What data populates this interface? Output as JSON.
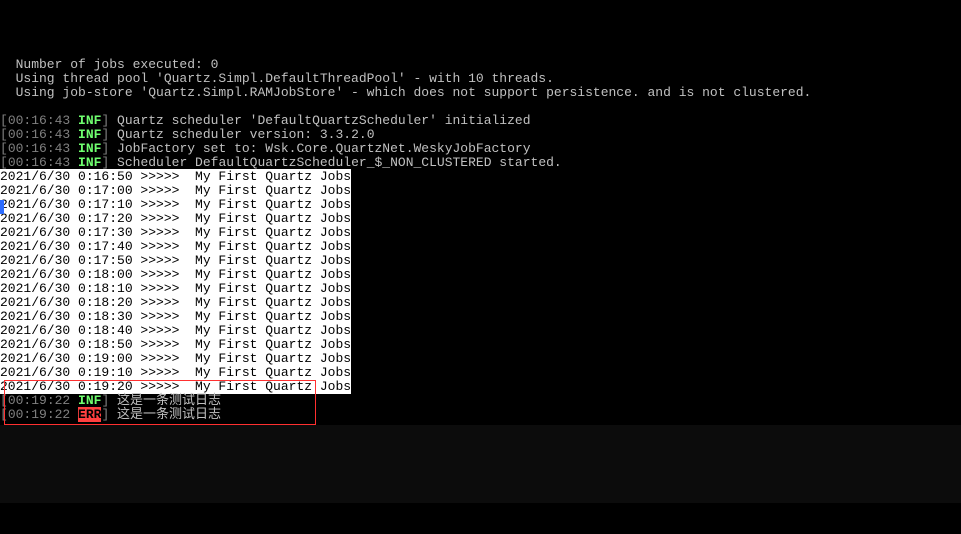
{
  "startup": [
    "  Number of jobs executed: 0",
    "  Using thread pool 'Quartz.Simpl.DefaultThreadPool' - with 10 threads.",
    "  Using job-store 'Quartz.Simpl.RAMJobStore' - which does not support persistence. and is not clustered.",
    ""
  ],
  "infoLines": [
    {
      "ts": "00:16:43",
      "level": "INF",
      "msg": "Quartz scheduler 'DefaultQuartzScheduler' initialized"
    },
    {
      "ts": "00:16:43",
      "level": "INF",
      "msg": "Quartz scheduler version: 3.3.2.0"
    },
    {
      "ts": "00:16:43",
      "level": "INF",
      "msg": "JobFactory set to: Wsk.Core.QuartzNet.WeskyJobFactory"
    },
    {
      "ts": "00:16:43",
      "level": "INF",
      "msg": "Scheduler DefaultQuartzScheduler_$_NON_CLUSTERED started."
    }
  ],
  "jobLines": [
    {
      "dt": "2021/6/30 0:16:50",
      "arrow": ">>>>>",
      "msg": "My First Quartz Jobs"
    },
    {
      "dt": "2021/6/30 0:17:00",
      "arrow": ">>>>>",
      "msg": "My First Quartz Jobs"
    },
    {
      "dt": "2021/6/30 0:17:10",
      "arrow": ">>>>>",
      "msg": "My First Quartz Jobs"
    },
    {
      "dt": "2021/6/30 0:17:20",
      "arrow": ">>>>>",
      "msg": "My First Quartz Jobs"
    },
    {
      "dt": "2021/6/30 0:17:30",
      "arrow": ">>>>>",
      "msg": "My First Quartz Jobs"
    },
    {
      "dt": "2021/6/30 0:17:40",
      "arrow": ">>>>>",
      "msg": "My First Quartz Jobs"
    },
    {
      "dt": "2021/6/30 0:17:50",
      "arrow": ">>>>>",
      "msg": "My First Quartz Jobs"
    },
    {
      "dt": "2021/6/30 0:18:00",
      "arrow": ">>>>>",
      "msg": "My First Quartz Jobs"
    },
    {
      "dt": "2021/6/30 0:18:10",
      "arrow": ">>>>>",
      "msg": "My First Quartz Jobs"
    },
    {
      "dt": "2021/6/30 0:18:20",
      "arrow": ">>>>>",
      "msg": "My First Quartz Jobs"
    },
    {
      "dt": "2021/6/30 0:18:30",
      "arrow": ">>>>>",
      "msg": "My First Quartz Jobs"
    },
    {
      "dt": "2021/6/30 0:18:40",
      "arrow": ">>>>>",
      "msg": "My First Quartz Jobs"
    },
    {
      "dt": "2021/6/30 0:18:50",
      "arrow": ">>>>>",
      "msg": "My First Quartz Jobs"
    },
    {
      "dt": "2021/6/30 0:19:00",
      "arrow": ">>>>>",
      "msg": "My First Quartz Jobs"
    },
    {
      "dt": "2021/6/30 0:19:10",
      "arrow": ">>>>>",
      "msg": "My First Quartz Jobs"
    },
    {
      "dt": "2021/6/30 0:19:20",
      "arrow": ">>>>>",
      "msg": "My First Quartz Jobs"
    }
  ],
  "testLog": [
    {
      "ts": "00:19:22",
      "level": "INF",
      "msg": "这是一条测试日志"
    },
    {
      "ts": "00:19:22",
      "level": "ERR",
      "msg": "这是一条测试日志"
    }
  ],
  "bracketL": "[",
  "bracketR": "]"
}
